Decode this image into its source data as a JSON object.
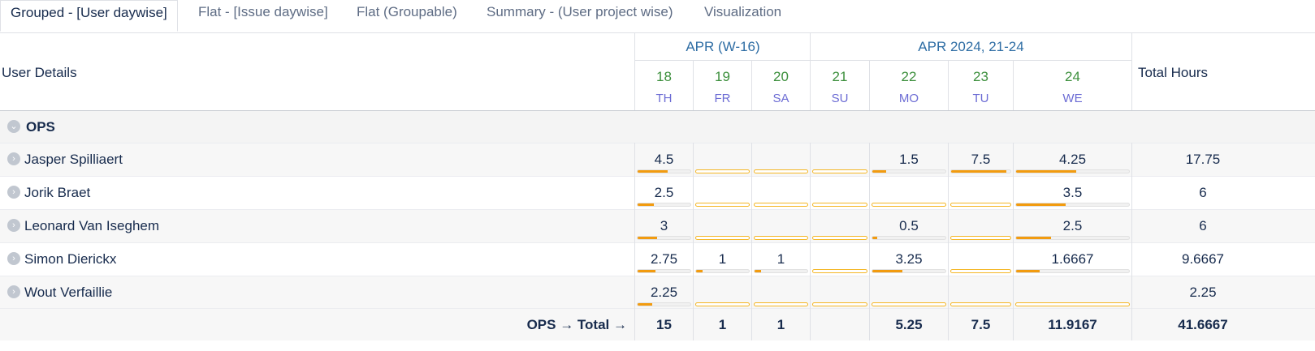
{
  "tabs": [
    {
      "label": "Grouped - [User daywise]",
      "active": true
    },
    {
      "label": "Flat - [Issue daywise]",
      "active": false
    },
    {
      "label": "Flat (Groupable)",
      "active": false
    },
    {
      "label": "Summary - (User project wise)",
      "active": false
    },
    {
      "label": "Visualization",
      "active": false
    }
  ],
  "header": {
    "user_details": "User Details",
    "total_hours": "Total Hours",
    "weeks": [
      "APR (W-16)",
      "APR 2024, 21-24"
    ],
    "days": [
      {
        "num": "18",
        "name": "TH"
      },
      {
        "num": "19",
        "name": "FR"
      },
      {
        "num": "20",
        "name": "SA"
      },
      {
        "num": "21",
        "name": "SU"
      },
      {
        "num": "22",
        "name": "MO"
      },
      {
        "num": "23",
        "name": "TU"
      },
      {
        "num": "24",
        "name": "WE"
      }
    ]
  },
  "group": {
    "name": "OPS",
    "total_label": "OPS → Total →"
  },
  "rows": [
    {
      "name": "Jasper Spilliaert",
      "values": [
        "4.5",
        "",
        "",
        "",
        "1.5",
        "7.5",
        "4.25"
      ],
      "fills": [
        0.5625,
        0,
        0,
        0,
        0.1875,
        0.9375,
        0.53125
      ],
      "total": "17.75"
    },
    {
      "name": "Jorik Braet",
      "values": [
        "2.5",
        "",
        "",
        "",
        "",
        "",
        "3.5"
      ],
      "fills": [
        0.3125,
        0,
        0,
        0,
        0,
        0,
        0.4375
      ],
      "total": "6"
    },
    {
      "name": "Leonard Van Iseghem",
      "values": [
        "3",
        "",
        "",
        "",
        "0.5",
        "",
        "2.5"
      ],
      "fills": [
        0.375,
        0,
        0,
        0,
        0.0625,
        0,
        0.3125
      ],
      "total": "6"
    },
    {
      "name": "Simon Dierickx",
      "values": [
        "2.75",
        "1",
        "1",
        "",
        "3.25",
        "",
        "1.6667"
      ],
      "fills": [
        0.34375,
        0.125,
        0.125,
        0,
        0.40625,
        0,
        0.208
      ],
      "total": "9.6667"
    },
    {
      "name": "Wout Verfaillie",
      "values": [
        "2.25",
        "",
        "",
        "",
        "",
        "",
        ""
      ],
      "fills": [
        0.28125,
        0,
        0,
        0,
        0,
        0,
        0
      ],
      "total": "2.25"
    }
  ],
  "totals": {
    "values": [
      "15",
      "1",
      "1",
      "",
      "5.25",
      "7.5",
      "11.9167"
    ],
    "total": "41.6667"
  },
  "colors": {
    "bar_fill": "#f29b0f",
    "bar_empty_border": "#f4b624",
    "week_text": "#2e6da4",
    "day_num": "#3c8f3c",
    "day_name": "#6c6cd4"
  }
}
